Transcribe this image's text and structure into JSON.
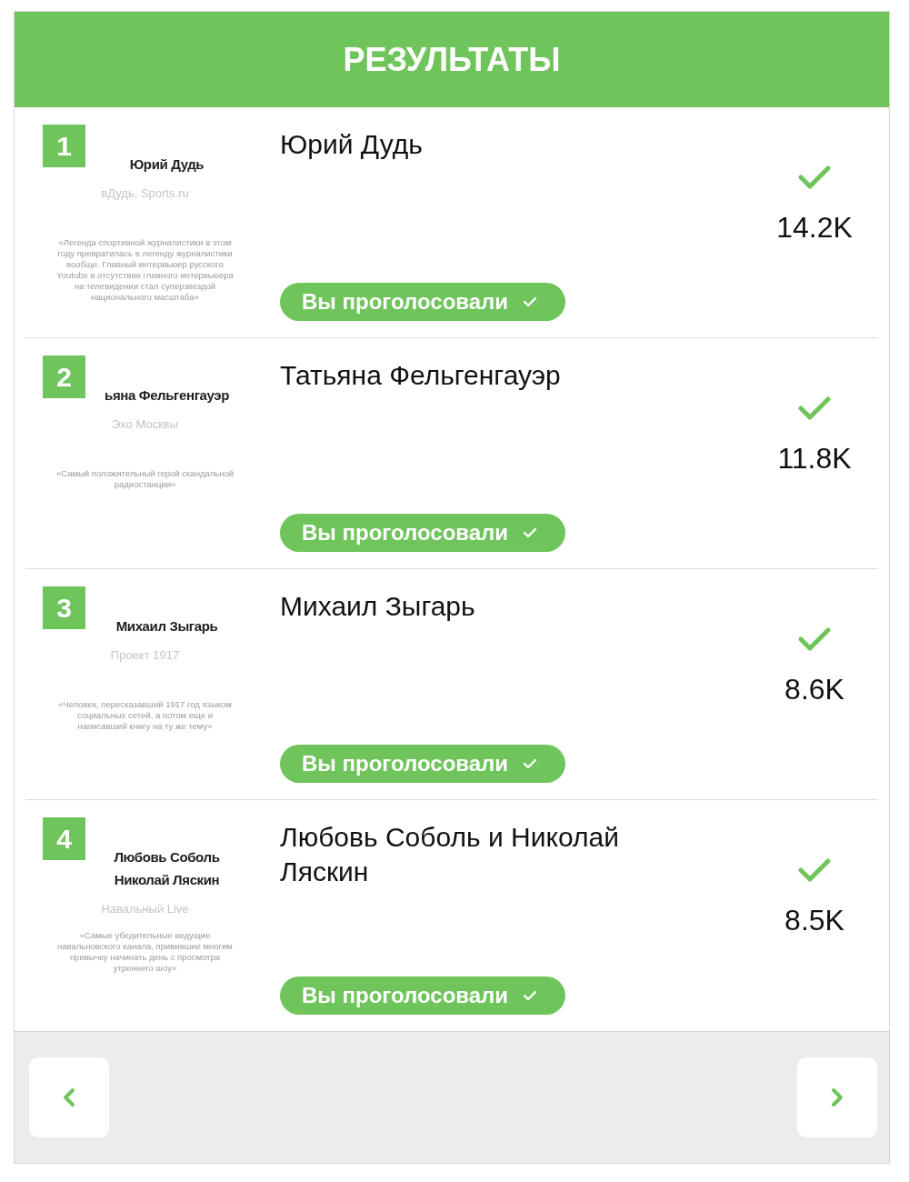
{
  "header": {
    "title": "РЕЗУЛЬТАТЫ"
  },
  "results": [
    {
      "rank": "1",
      "thumbnail": {
        "title_lines": [
          "Юрий Дудь"
        ],
        "source": "вДудь, Sports.ru",
        "quote": "«Легенда спортивной журналистики в этом году превратилась в легенду журналистики вообще. Главный интервьюер русского Youtube в отсутствие главного интервьюера на телевидении стал суперзвездой национального масштаба»"
      },
      "name": "Юрий Дудь",
      "vote_button": {
        "label": "Вы проголосовали"
      },
      "voted": true,
      "count": "14.2K"
    },
    {
      "rank": "2",
      "thumbnail": {
        "title_lines": [
          "ьяна Фельгенгауэр"
        ],
        "source": "Эхо Москвы",
        "quote": "«Самый положительный герой скандальной радиостанции»"
      },
      "name": "Татьяна Фельгенгауэр",
      "vote_button": {
        "label": "Вы проголосовали"
      },
      "voted": true,
      "count": "11.8K"
    },
    {
      "rank": "3",
      "thumbnail": {
        "title_lines": [
          "Михаил Зыгарь"
        ],
        "source": "Проект 1917",
        "quote": "«Человек, пересказавший 1917 год языком социальных сетей, а потом еще и написавший книгу на ту же тему»"
      },
      "name": "Михаил Зыгарь",
      "vote_button": {
        "label": "Вы проголосовали"
      },
      "voted": true,
      "count": "8.6K"
    },
    {
      "rank": "4",
      "thumbnail": {
        "title_lines": [
          "Любовь Соболь",
          "Николай Ляскин"
        ],
        "source": "Навальный Live",
        "quote": "«Самые убедительные ведущие навальновского канала, привившие многим привычку начинать день с просмотра утреннего шоу»"
      },
      "name": "Любовь Соболь и Николай Ляскин",
      "vote_button": {
        "label": "Вы проголосовали"
      },
      "voted": true,
      "count": "8.5K"
    }
  ]
}
